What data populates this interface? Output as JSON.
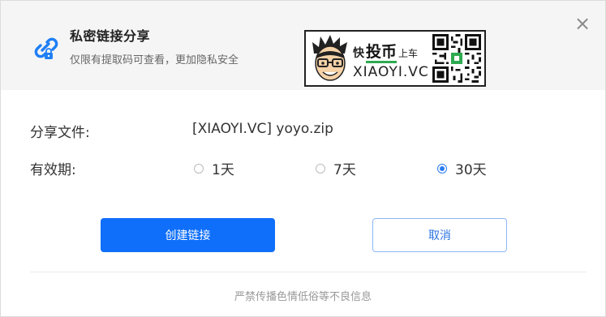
{
  "dialog": {
    "title": "私密链接分享",
    "subtitle": "仅限有提取码可查看，更加隐私安全",
    "close_label": "×",
    "icon": "link-lock-icon"
  },
  "banner": {
    "part1": "快",
    "part2": "投币",
    "part3": "上车",
    "domain": "XIAOYI.VC",
    "qr_icon": "qr-code-icon",
    "accent": "#2eaa50"
  },
  "file": {
    "label": "分享文件:",
    "name": "[XIAOYI.VC] yoyo.zip"
  },
  "validity": {
    "label": "有效期:",
    "options": [
      {
        "label": "1天",
        "selected": false
      },
      {
        "label": "7天",
        "selected": false
      },
      {
        "label": "30天",
        "selected": true
      }
    ]
  },
  "actions": {
    "create_label": "创建链接",
    "cancel_label": "取消"
  },
  "footer": {
    "notice": "严禁传播色情低俗等不良信息"
  },
  "colors": {
    "primary": "#0f6ffa",
    "header_bg": "#f5f5f5"
  }
}
